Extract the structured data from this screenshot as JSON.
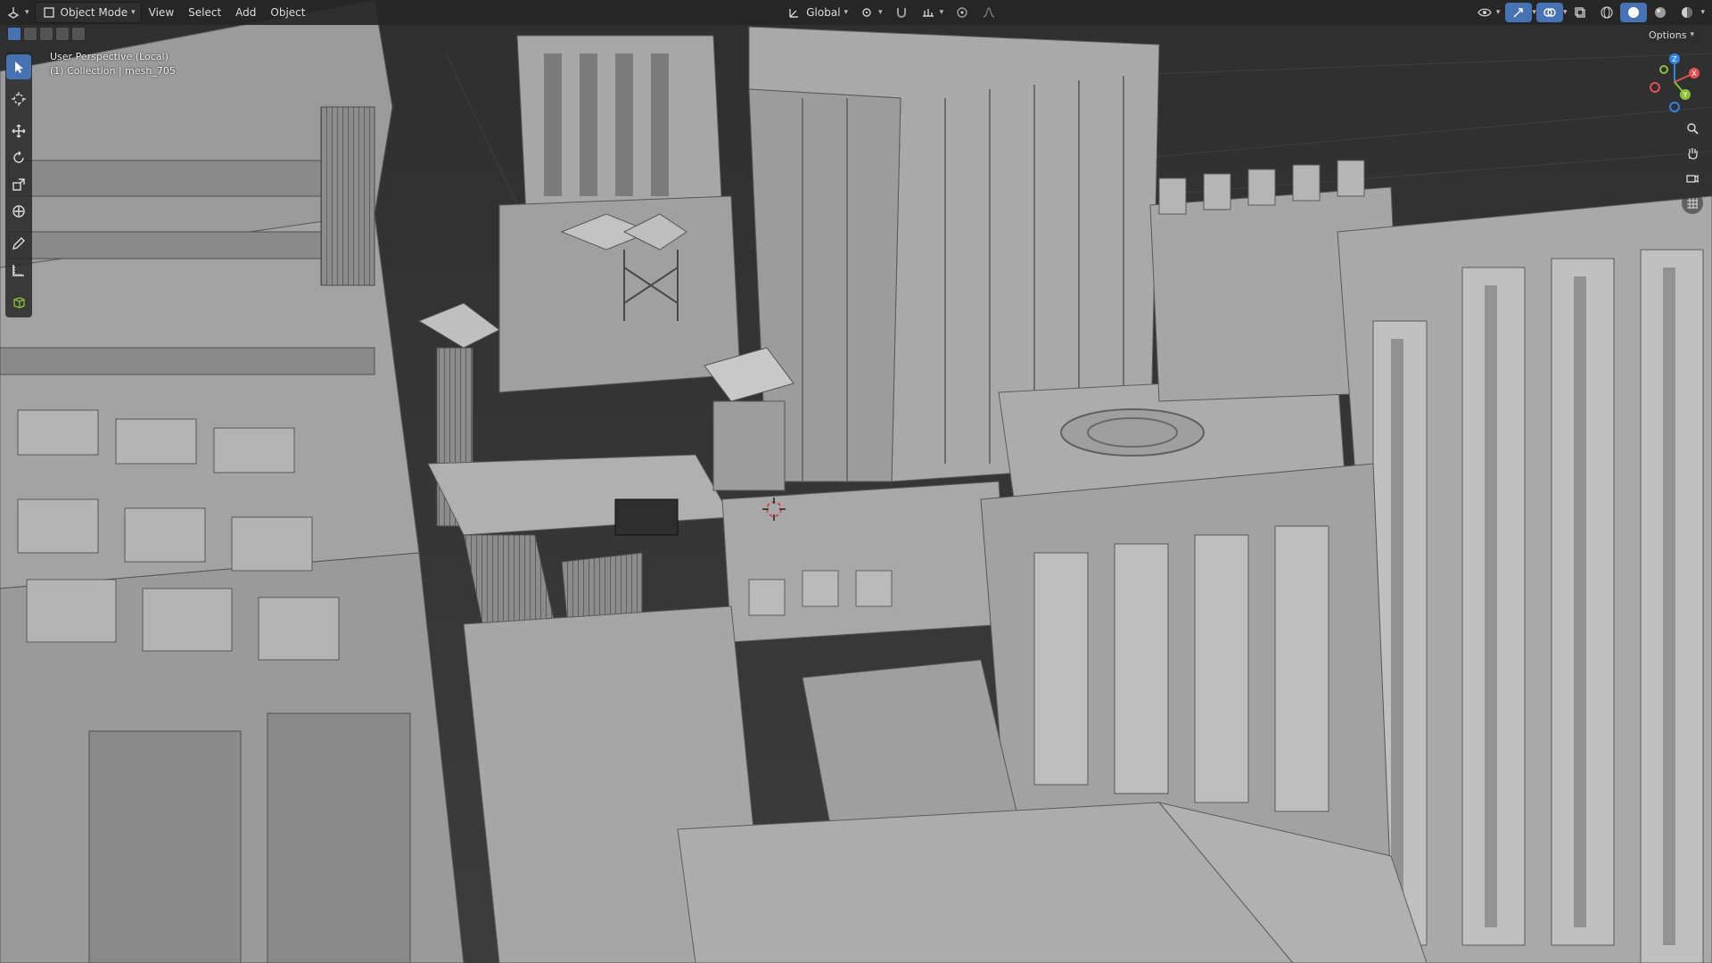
{
  "header": {
    "editor_type_icon": "3d-viewport-icon",
    "mode_label": "Object Mode",
    "menus": [
      "View",
      "Select",
      "Add",
      "Object"
    ],
    "transform_orientation": "Global",
    "pivot_icon": "pivot-point-icon",
    "snap_icon": "snap-magnet-icon",
    "proportional_icon": "proportional-editing-icon"
  },
  "viewport": {
    "perspective_label": "User Perspective (Local)",
    "collection_label": "(1) Collection | mesh_705",
    "options_label": "Options"
  },
  "toolbar": {
    "tools": [
      "select-box",
      "cursor",
      "move",
      "rotate",
      "scale",
      "transform",
      "annotate",
      "measure",
      "add-cube"
    ],
    "active_tool": "select-box"
  },
  "gizmo": {
    "axes": [
      "X",
      "Y",
      "Z"
    ],
    "colors": {
      "x": "#e35151",
      "y": "#8bbf3c",
      "z": "#2f83e4"
    }
  },
  "colors": {
    "accent": "#4772b3",
    "header_bg": "#262626",
    "viewport_bg": "#3a3a3a"
  }
}
